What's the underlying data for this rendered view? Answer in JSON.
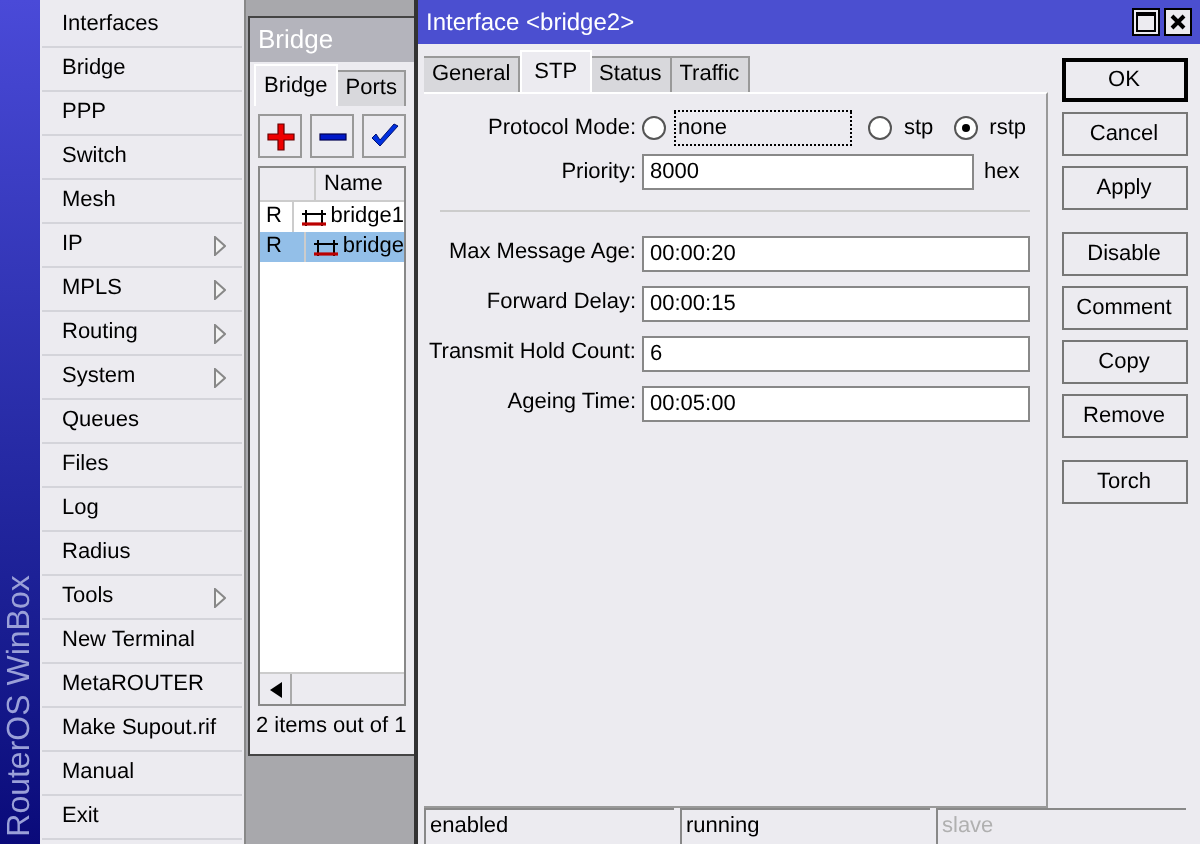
{
  "brand": "RouterOS WinBox",
  "menu": [
    {
      "label": "Interfaces",
      "submenu": false
    },
    {
      "label": "Bridge",
      "submenu": false
    },
    {
      "label": "PPP",
      "submenu": false
    },
    {
      "label": "Switch",
      "submenu": false
    },
    {
      "label": "Mesh",
      "submenu": false
    },
    {
      "label": "IP",
      "submenu": true
    },
    {
      "label": "MPLS",
      "submenu": true
    },
    {
      "label": "Routing",
      "submenu": true
    },
    {
      "label": "System",
      "submenu": true
    },
    {
      "label": "Queues",
      "submenu": false
    },
    {
      "label": "Files",
      "submenu": false
    },
    {
      "label": "Log",
      "submenu": false
    },
    {
      "label": "Radius",
      "submenu": false
    },
    {
      "label": "Tools",
      "submenu": true
    },
    {
      "label": "New Terminal",
      "submenu": false
    },
    {
      "label": "MetaROUTER",
      "submenu": false
    },
    {
      "label": "Make Supout.rif",
      "submenu": false
    },
    {
      "label": "Manual",
      "submenu": false
    },
    {
      "label": "Exit",
      "submenu": false
    }
  ],
  "bridge_window": {
    "title": "Bridge",
    "tabs": [
      {
        "label": "Bridge",
        "selected": true
      },
      {
        "label": "Ports",
        "selected": false
      }
    ],
    "toolbar": [
      {
        "kind": "add"
      },
      {
        "kind": "remove"
      },
      {
        "kind": "enable"
      }
    ],
    "columns": [
      "Name"
    ],
    "rows": [
      {
        "flag": "R",
        "name": "bridge1",
        "selected": false
      },
      {
        "flag": "R",
        "name": "bridge",
        "selected": true
      }
    ],
    "footer": "2 items out of 1"
  },
  "dialog": {
    "title": "Interface <bridge2>",
    "tabs": [
      {
        "label": "General",
        "selected": false
      },
      {
        "label": "STP",
        "selected": true
      },
      {
        "label": "Status",
        "selected": false
      },
      {
        "label": "Traffic",
        "selected": false
      }
    ],
    "protocol_mode": {
      "label": "Protocol Mode:",
      "options": [
        {
          "label": "none",
          "selected": false,
          "focused": true
        },
        {
          "label": "stp",
          "selected": false,
          "focused": false
        },
        {
          "label": "rstp",
          "selected": true,
          "focused": false
        }
      ]
    },
    "priority": {
      "label": "Priority:",
      "value": "8000",
      "unit": "hex"
    },
    "fields": [
      {
        "label": "Max Message Age:",
        "value": "00:00:20"
      },
      {
        "label": "Forward Delay:",
        "value": "00:00:15"
      },
      {
        "label": "Transmit Hold Count:",
        "value": "6"
      },
      {
        "label": "Ageing Time:",
        "value": "00:05:00"
      }
    ],
    "button_groups": [
      [
        {
          "label": "OK",
          "default": true
        },
        {
          "label": "Cancel",
          "default": false
        },
        {
          "label": "Apply",
          "default": false
        }
      ],
      [
        {
          "label": "Disable",
          "default": false
        },
        {
          "label": "Comment",
          "default": false
        },
        {
          "label": "Copy",
          "default": false
        },
        {
          "label": "Remove",
          "default": false
        }
      ],
      [
        {
          "label": "Torch",
          "default": false
        }
      ]
    ],
    "status_bar": [
      {
        "text": "enabled",
        "disabled": false
      },
      {
        "text": "running",
        "disabled": false
      },
      {
        "text": "slave",
        "disabled": true
      }
    ]
  }
}
